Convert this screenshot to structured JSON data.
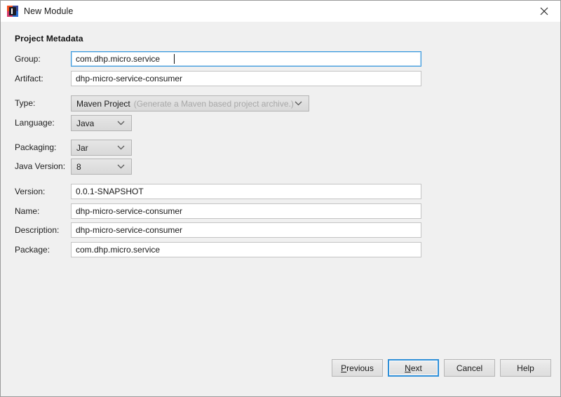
{
  "window": {
    "title": "New Module",
    "icon": "intellij-module-icon",
    "close_label": "Close",
    "close_icon": "close-icon"
  },
  "form": {
    "section_title": "Project Metadata",
    "fields": [
      {
        "id": "group",
        "label": "Group:",
        "kind": "text",
        "value": "com.dhp.micro.service",
        "placeholder": "",
        "focused": true
      },
      {
        "id": "artifact",
        "label": "Artifact:",
        "kind": "text",
        "value": "dhp-micro-service-consumer",
        "placeholder": "",
        "focused": false
      },
      {
        "id": "type",
        "label": "Type:",
        "kind": "combo-wide",
        "value": "Maven Project",
        "hint": "(Generate a Maven based project archive.)",
        "icon": "chevron-down-icon"
      },
      {
        "id": "language",
        "label": "Language:",
        "kind": "combo-small",
        "value": "Java",
        "icon": "chevron-down-icon"
      },
      {
        "id": "packaging",
        "label": "Packaging:",
        "kind": "combo-small",
        "value": "Jar",
        "icon": "chevron-down-icon"
      },
      {
        "id": "java-version",
        "label": "Java Version:",
        "kind": "combo-small",
        "value": "8",
        "icon": "chevron-down-icon"
      },
      {
        "id": "version",
        "label": "Version:",
        "kind": "text",
        "value": "0.0.1-SNAPSHOT",
        "placeholder": "",
        "focused": false
      },
      {
        "id": "name",
        "label": "Name:",
        "kind": "text",
        "value": "dhp-micro-service-consumer",
        "placeholder": "",
        "focused": false
      },
      {
        "id": "description",
        "label": "Description:",
        "kind": "text",
        "value": "dhp-micro-service-consumer",
        "placeholder": "",
        "focused": false
      },
      {
        "id": "package",
        "label": "Package:",
        "kind": "text",
        "value": "com.dhp.micro.service",
        "placeholder": "",
        "focused": false
      }
    ]
  },
  "buttons": {
    "previous": {
      "label": "Previous",
      "mnemonic": "P"
    },
    "next": {
      "label": "Next",
      "mnemonic": "N",
      "default": true
    },
    "cancel": {
      "label": "Cancel"
    },
    "help": {
      "label": "Help"
    }
  },
  "colors": {
    "accent": "#2e8fd8",
    "focus_border": "#3c9ade",
    "dialog_bg": "#f0f0f0",
    "titlebar_bg": "#ffffff",
    "input_bg": "#ffffff",
    "hint_text": "#a8a8a8"
  }
}
